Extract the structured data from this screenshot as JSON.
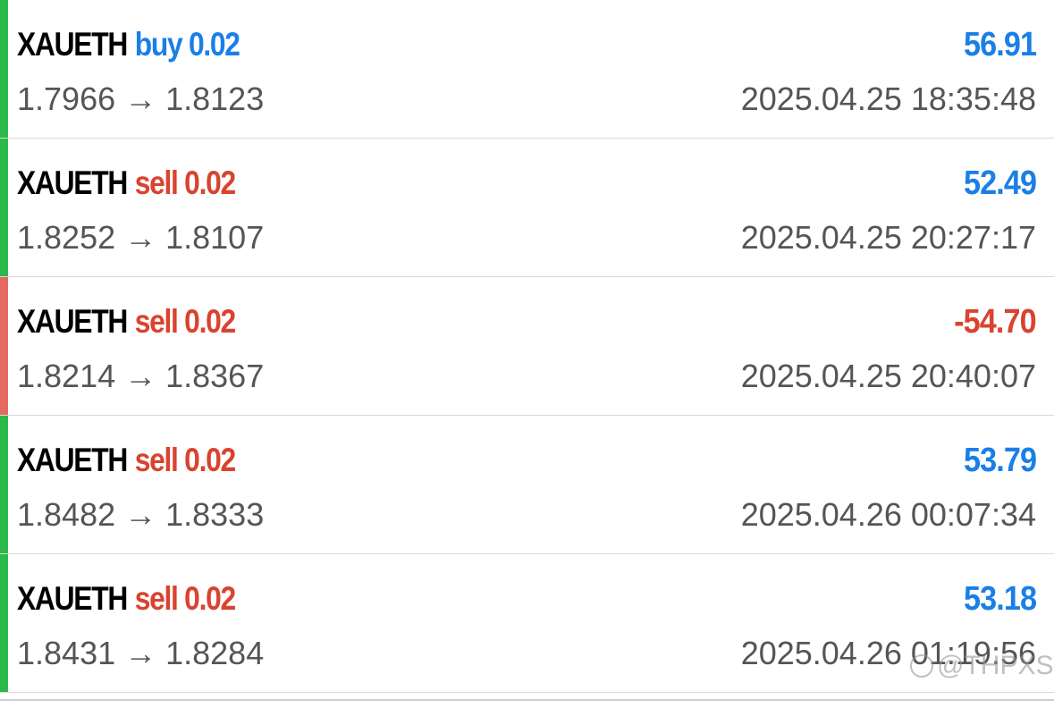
{
  "colors": {
    "profit_bar": "#2db84a",
    "loss_bar": "#e46a5f",
    "buy": "#1a7fe6",
    "sell": "#d9432f",
    "positive": "#1a7fe6",
    "negative": "#d9432f"
  },
  "trades": [
    {
      "symbol": "XAUETH",
      "side": "buy",
      "volume": "0.02",
      "profit": "56.91",
      "open_price": "1.7966",
      "close_price": "1.8123",
      "arrow": "→",
      "time": "2025.04.25 18:35:48",
      "result": "profit"
    },
    {
      "symbol": "XAUETH",
      "side": "sell",
      "volume": "0.02",
      "profit": "52.49",
      "open_price": "1.8252",
      "close_price": "1.8107",
      "arrow": "→",
      "time": "2025.04.25 20:27:17",
      "result": "profit"
    },
    {
      "symbol": "XAUETH",
      "side": "sell",
      "volume": "0.02",
      "profit": "-54.70",
      "open_price": "1.8214",
      "close_price": "1.8367",
      "arrow": "→",
      "time": "2025.04.25 20:40:07",
      "result": "loss"
    },
    {
      "symbol": "XAUETH",
      "side": "sell",
      "volume": "0.02",
      "profit": "53.79",
      "open_price": "1.8482",
      "close_price": "1.8333",
      "arrow": "→",
      "time": "2025.04.26 00:07:34",
      "result": "profit"
    },
    {
      "symbol": "XAUETH",
      "side": "sell",
      "volume": "0.02",
      "profit": "53.18",
      "open_price": "1.8431",
      "close_price": "1.8284",
      "arrow": "→",
      "time": "2025.04.26 01:19:56",
      "result": "profit"
    }
  ],
  "watermark": {
    "text": "@THPXS"
  }
}
